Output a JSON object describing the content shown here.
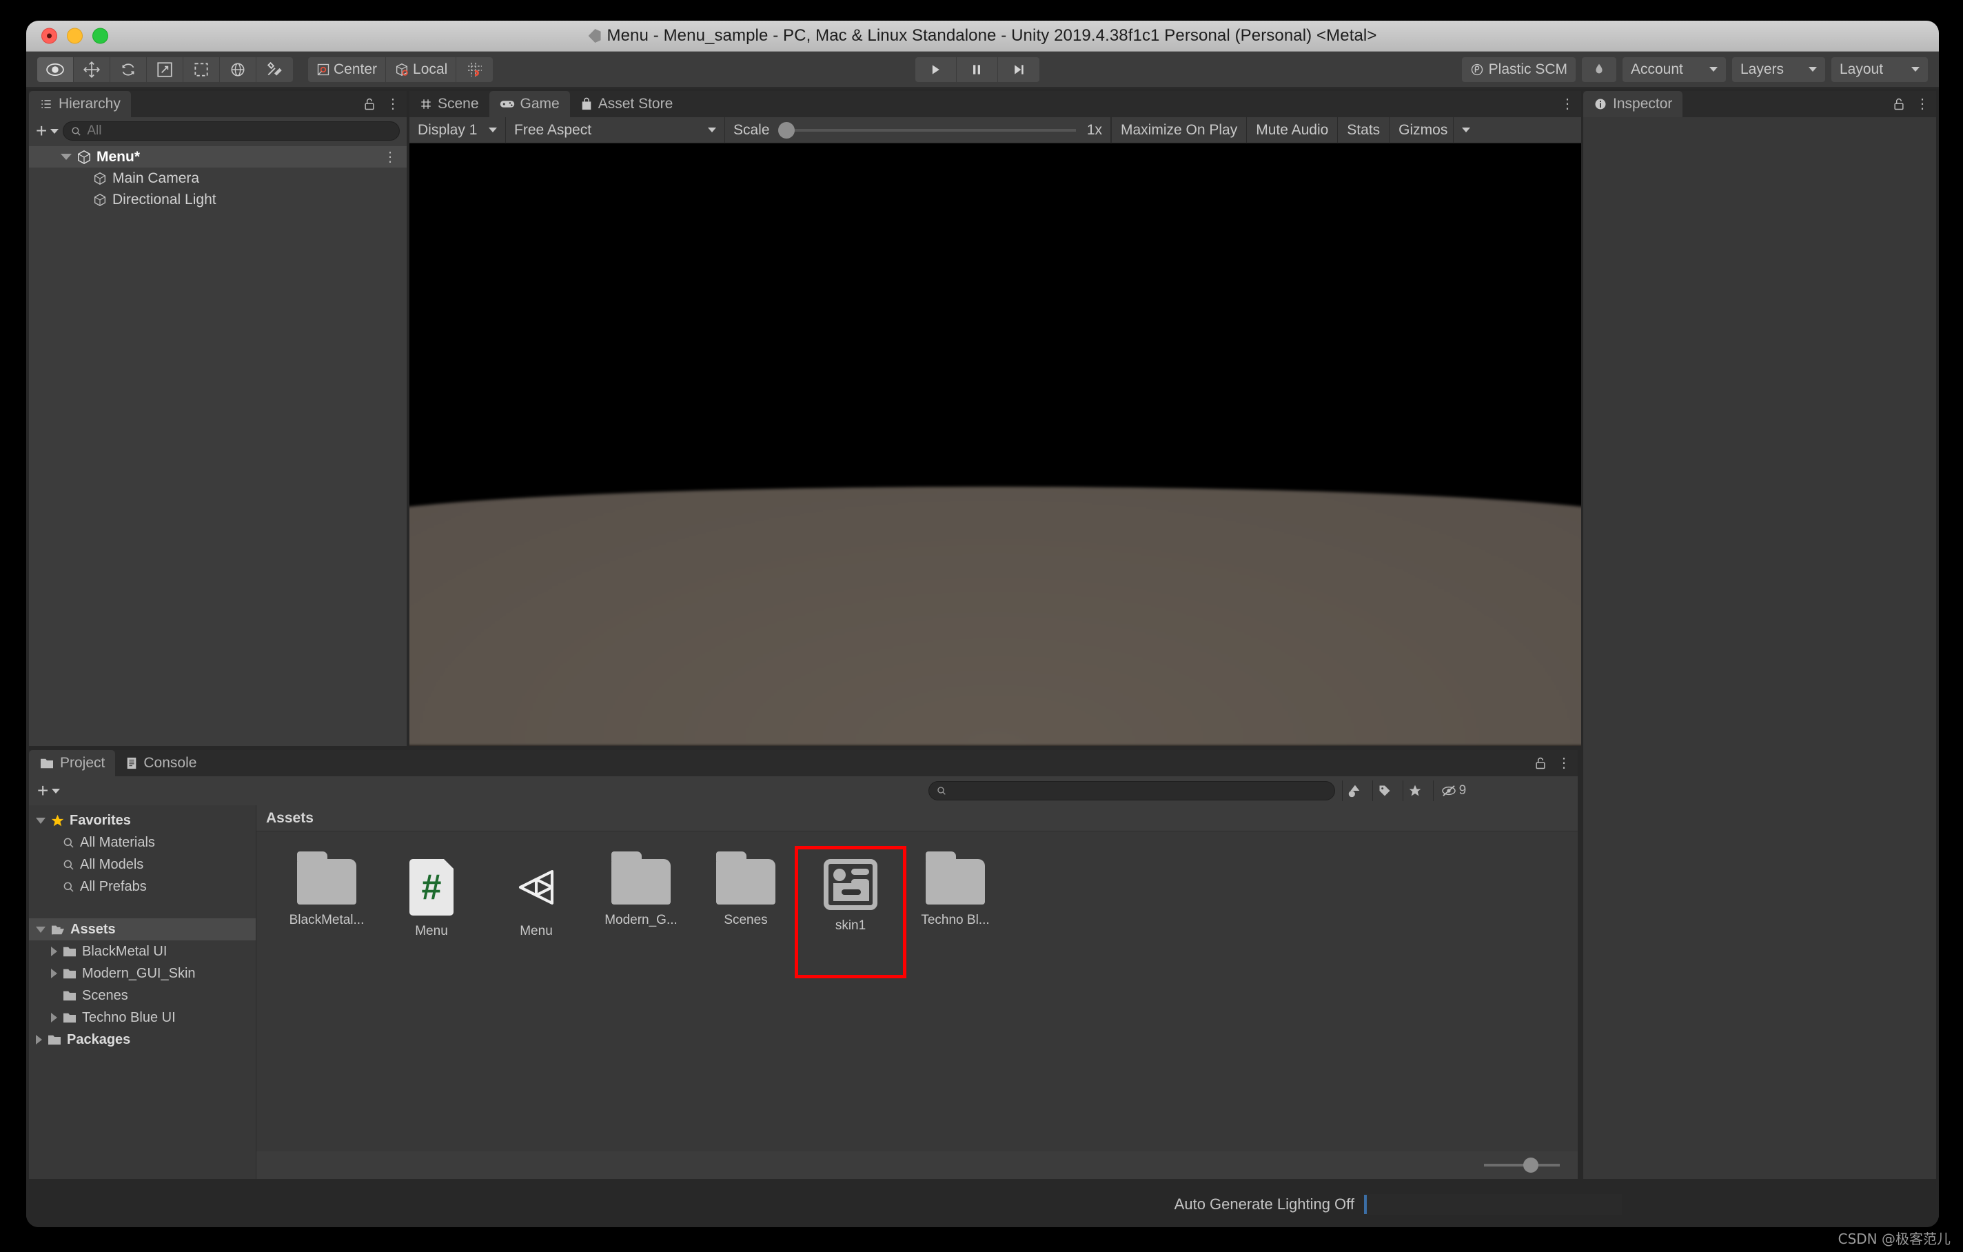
{
  "window": {
    "title": "Menu - Menu_sample - PC, Mac & Linux Standalone - Unity 2019.4.38f1c1 Personal (Personal) <Metal>",
    "traffic_lights": [
      "close",
      "minimize",
      "zoom"
    ]
  },
  "toolbar": {
    "tools": [
      {
        "name": "hand-tool",
        "icon": "eye-icon",
        "active": true
      },
      {
        "name": "move-tool",
        "icon": "move-icon",
        "active": false
      },
      {
        "name": "rotate-tool",
        "icon": "rotate-icon",
        "active": false
      },
      {
        "name": "scale-tool",
        "icon": "scale-icon",
        "active": false
      },
      {
        "name": "rect-tool",
        "icon": "rect-icon",
        "active": false
      },
      {
        "name": "transform-tool",
        "icon": "transform-icon",
        "active": false
      },
      {
        "name": "custom-editor-tool",
        "icon": "wrench-icon",
        "active": false
      }
    ],
    "pivot_mode": "Center",
    "pivot_rotation": "Local",
    "snap_label": "",
    "play": "play-icon",
    "pause": "pause-icon",
    "step": "step-icon",
    "plastic_scm": "Plastic SCM",
    "cloud": "cloud-icon",
    "account": "Account",
    "layers": "Layers",
    "layout": "Layout"
  },
  "hierarchy": {
    "tab_label": "Hierarchy",
    "search_placeholder": "All",
    "add_label": "+",
    "items": [
      {
        "label": "Menu*",
        "depth": 0,
        "selected": true,
        "expanded": true,
        "icon": "unity-scene-icon"
      },
      {
        "label": "Main Camera",
        "depth": 1,
        "selected": false,
        "icon": "gameobject-icon"
      },
      {
        "label": "Directional Light",
        "depth": 1,
        "selected": false,
        "icon": "gameobject-icon"
      }
    ]
  },
  "center_panel": {
    "tabs": [
      {
        "label": "Scene",
        "icon": "grid-icon",
        "active": false
      },
      {
        "label": "Game",
        "icon": "gamepad-icon",
        "active": true
      },
      {
        "label": "Asset Store",
        "icon": "shopping-bag-icon",
        "active": false
      }
    ],
    "game_toolbar": {
      "display": "Display 1",
      "aspect": "Free Aspect",
      "scale_label": "Scale",
      "scale_value": "1x",
      "maximize_on_play": "Maximize On Play",
      "mute_audio": "Mute Audio",
      "stats": "Stats",
      "gizmos": "Gizmos"
    }
  },
  "inspector": {
    "tab_label": "Inspector",
    "icon": "info-icon"
  },
  "project": {
    "tabs": [
      {
        "label": "Project",
        "icon": "folder-icon",
        "active": true
      },
      {
        "label": "Console",
        "icon": "console-icon",
        "active": false
      }
    ],
    "add_label": "+",
    "search_placeholder": "",
    "search_value": "",
    "filter_icons": [
      "asset-type-filter-icon",
      "label-filter-icon",
      "favorite-filter-icon"
    ],
    "hidden_count": "9",
    "breadcrumb": "Assets",
    "tree": [
      {
        "label": "Favorites",
        "depth": 0,
        "expanded": true,
        "bold": true,
        "icon": "star-icon"
      },
      {
        "label": "All Materials",
        "depth": 1,
        "icon": "search-icon"
      },
      {
        "label": "All Models",
        "depth": 1,
        "icon": "search-icon"
      },
      {
        "label": "All Prefabs",
        "depth": 1,
        "icon": "search-icon"
      },
      {
        "label": "",
        "depth": 0,
        "icon": "spacer"
      },
      {
        "label": "Assets",
        "depth": 0,
        "expanded": true,
        "bold": true,
        "selected": true,
        "icon": "folder-open-icon"
      },
      {
        "label": "BlackMetal UI",
        "depth": 1,
        "collapsed": true,
        "icon": "folder-icon"
      },
      {
        "label": "Modern_GUI_Skin",
        "depth": 1,
        "collapsed": true,
        "icon": "folder-icon"
      },
      {
        "label": "Scenes",
        "depth": 1,
        "icon": "folder-icon"
      },
      {
        "label": "Techno Blue UI",
        "depth": 1,
        "collapsed": true,
        "icon": "folder-icon"
      },
      {
        "label": "Packages",
        "depth": 0,
        "collapsed": true,
        "bold": true,
        "icon": "folder-icon"
      }
    ],
    "assets": [
      {
        "label": "BlackMetal...",
        "icon": "folder-icon",
        "highlight": false
      },
      {
        "label": "Menu",
        "icon": "csharp-script-icon",
        "highlight": false
      },
      {
        "label": "Menu",
        "icon": "unity-scene-icon",
        "highlight": false
      },
      {
        "label": "Modern_G...",
        "icon": "folder-icon",
        "highlight": false
      },
      {
        "label": "Scenes",
        "icon": "folder-icon",
        "highlight": false
      },
      {
        "label": "skin1",
        "icon": "gui-skin-icon",
        "highlight": true
      },
      {
        "label": "Techno Bl...",
        "icon": "folder-icon",
        "highlight": false
      }
    ]
  },
  "statusbar": {
    "text": "Auto Generate Lighting Off"
  },
  "watermark": "CSDN @极客范儿",
  "colors": {
    "accent_red": "#ff0000",
    "panel_bg": "#383838",
    "toolbar_bg": "#3c3c3c",
    "window_bg": "#282828",
    "text": "#c8c8c8",
    "star_yellow": "#ffc107",
    "csharp_green": "#1d6b2e"
  }
}
